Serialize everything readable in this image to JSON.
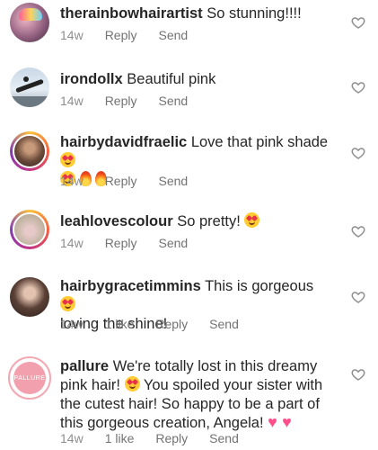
{
  "comments": [
    {
      "username": "therainbowhairartist",
      "text": " So stunning!!!!",
      "age": "14w",
      "likes": "",
      "reply": "Reply",
      "send": "Send"
    },
    {
      "username": "irondollx",
      "text": " Beautiful pink",
      "age": "14w",
      "likes": "",
      "reply": "Reply",
      "send": "Send"
    },
    {
      "username": "hairbydavidfraelic",
      "text": " Love that pink shade ",
      "age": "14w",
      "likes": "",
      "reply": "Reply",
      "send": "Send"
    },
    {
      "username": "leahlovescolour",
      "text": " So pretty! ",
      "age": "14w",
      "likes": "",
      "reply": "Reply",
      "send": "Send"
    },
    {
      "username": "hairbygracetimmins",
      "text": " This is gorgeous ",
      "text2": "loving the shine!",
      "age": "14w",
      "likes": "1 like",
      "reply": "Reply",
      "send": "Send"
    },
    {
      "username": "pallure",
      "avatar_text": "PALLURE",
      "text": " We're totally lost in this dreamy pink hair! ",
      "text2": " You spoiled your sister with the cutest hair! So happy to be a part of this gorgeous creation, Angela! ",
      "age": "14w",
      "likes": "1 like",
      "reply": "Reply",
      "send": "Send"
    }
  ],
  "icons": {
    "like": "heart-outline-icon"
  },
  "colors": {
    "meta": "#8e8e8e",
    "text": "#262626",
    "accent_ring": "#c13584"
  }
}
